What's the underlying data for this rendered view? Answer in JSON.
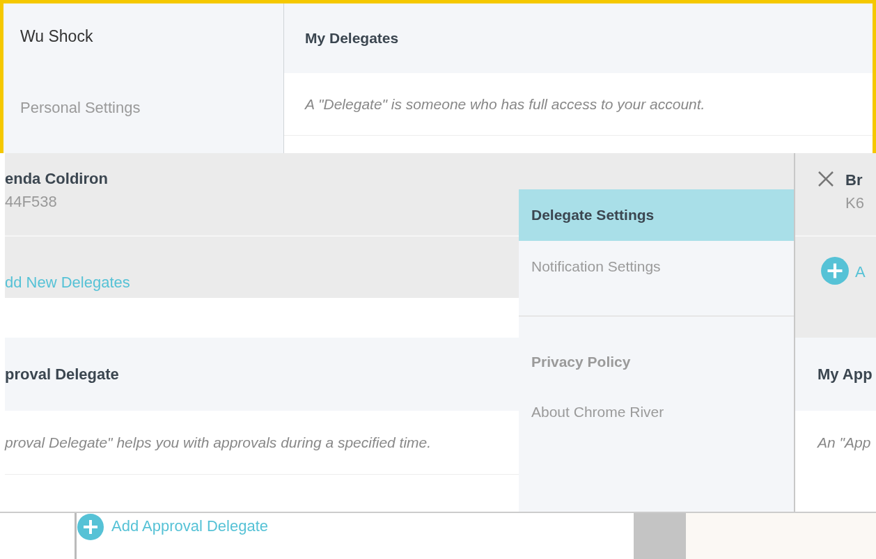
{
  "sidebar": {
    "user_name": "Wu Shock",
    "items": [
      {
        "label": "Personal Settings",
        "selected": false
      }
    ]
  },
  "delegates_panel": {
    "title": "My Delegates",
    "description": "A \"Delegate\" is someone who has full access to your account."
  },
  "delegate_card": {
    "name": "enda Coldiron",
    "id": "44F538",
    "add_link": "dd New Delegates"
  },
  "approval_section": {
    "title": "proval Delegate",
    "description": "proval Delegate\" helps you with approvals during a specified time.",
    "add_link": "Add Approval Delegate"
  },
  "settings_menu": {
    "groups": [
      [
        {
          "label": "Delegate Settings",
          "kind": "link",
          "selected": true
        },
        {
          "label": "Notification Settings",
          "kind": "link",
          "selected": false
        }
      ],
      [
        {
          "label": "Privacy Policy",
          "kind": "heading",
          "selected": false
        },
        {
          "label": "About Chrome River",
          "kind": "link",
          "selected": false
        }
      ]
    ]
  },
  "right_card": {
    "name": "Br",
    "id": "K6",
    "add_link": "A",
    "section_title": "My App",
    "section_description": "An \"App"
  }
}
